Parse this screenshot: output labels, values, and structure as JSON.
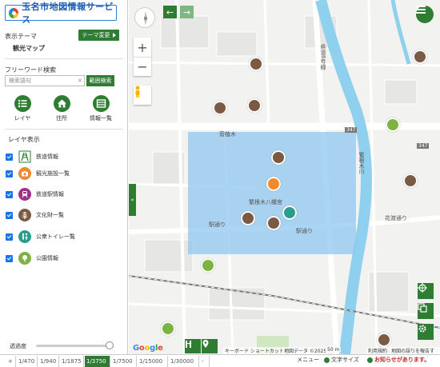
{
  "sidebar": {
    "logo_text": "玉名市地図情報サービス",
    "theme_label": "表示テーマ",
    "theme_name": "観光マップ",
    "theme_change_label": "テーマ変更",
    "freeword_label": "フリーワード検索",
    "search_placeholder": "検索語句",
    "range_search_label": "範囲検索",
    "tools": [
      {
        "label": "レイヤ"
      },
      {
        "label": "住所"
      },
      {
        "label": "情報一覧"
      }
    ],
    "layer_title": "レイヤ表示",
    "layers": [
      {
        "label": "鉄道情報",
        "color": "#2e7d32",
        "checked": true
      },
      {
        "label": "観光施設一覧",
        "color": "#ef8a2f",
        "checked": true
      },
      {
        "label": "鉄道駅情報",
        "color": "#a0308a",
        "checked": true
      },
      {
        "label": "文化財一覧",
        "color": "#7b5a44",
        "checked": true
      },
      {
        "label": "公衆トイレ一覧",
        "color": "#2a9d8f",
        "checked": true
      },
      {
        "label": "公園情報",
        "color": "#7cb342",
        "checked": true
      }
    ],
    "opacity_label": "透過度",
    "opacity_value": 1.0
  },
  "scale": {
    "items": [
      "+",
      "1/470",
      "1/940",
      "1/1875",
      "1/3750",
      "1/7500",
      "1/15000",
      "1/30000",
      "-"
    ],
    "active": "1/3750"
  },
  "footer": {
    "menu": "メニュー",
    "text_size": "文字サイズ",
    "notice": "お知らせがあります。"
  },
  "map": {
    "labels": {
      "road_kinkyo": "菅植木",
      "river": "繁根木川",
      "shrine": "繁根木八幡宮",
      "ekidori_1": "駅通り",
      "ekidori_2": "駅通り",
      "hanaza": "花渡通り",
      "prefectural_road": "県道6号線",
      "route_347_a": "347",
      "route_347_b": "347",
      "keyboard": "キーボード ショートカット",
      "map_data": "地図データ ©2025",
      "scale_text": "50 m",
      "terms": "利用規約",
      "report": "地図の誤りを報告する"
    },
    "google": "Google",
    "back_label": "←",
    "forward_label": "→",
    "zoom_in": "+",
    "zoom_out": "−",
    "collapse_label": "«"
  },
  "colors": {
    "green": "#2e7d32",
    "highlight": "#8fc7f0",
    "river": "#8fd0ee"
  }
}
